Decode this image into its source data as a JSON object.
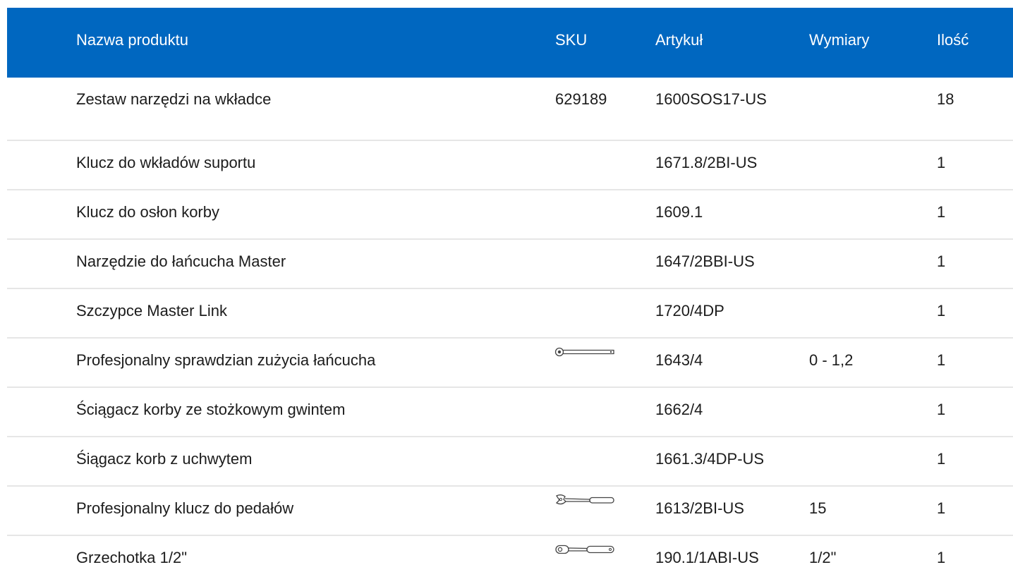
{
  "columns": {
    "name": "Nazwa produktu",
    "sku": "SKU",
    "article": "Artykuł",
    "dimensions": "Wymiary",
    "quantity": "Ilość"
  },
  "rows": [
    {
      "name": "Zestaw narzędzi na wkładce",
      "sku": "629189",
      "article": "1600SOS17-US",
      "dimensions": "",
      "quantity": "18",
      "image": null
    },
    {
      "name": "Klucz do wkładów suportu",
      "sku": "",
      "article": "1671.8/2BI-US",
      "dimensions": "",
      "quantity": "1",
      "image": null
    },
    {
      "name": "Klucz do osłon korby",
      "sku": "",
      "article": "1609.1",
      "dimensions": "",
      "quantity": "1",
      "image": null
    },
    {
      "name": "Narzędzie do łańcucha Master",
      "sku": "",
      "article": "1647/2BBI-US",
      "dimensions": "",
      "quantity": "1",
      "image": null
    },
    {
      "name": "Szczypce Master Link",
      "sku": "",
      "article": "1720/4DP",
      "dimensions": "",
      "quantity": "1",
      "image": null
    },
    {
      "name": "Profesjonalny sprawdzian zużycia łańcucha",
      "sku": "",
      "article": "1643/4",
      "dimensions": "0 - 1,2",
      "quantity": "1",
      "image": "chain-wear-gauge-icon"
    },
    {
      "name": "Ściągacz korby ze stożkowym gwintem",
      "sku": "",
      "article": "1662/4",
      "dimensions": "",
      "quantity": "1",
      "image": null
    },
    {
      "name": "Śiągacz korb z uchwytem",
      "sku": "",
      "article": "1661.3/4DP-US",
      "dimensions": "",
      "quantity": "1",
      "image": null
    },
    {
      "name": "Profesjonalny klucz do pedałów",
      "sku": "",
      "article": "1613/2BI-US",
      "dimensions": "15",
      "quantity": "1",
      "image": "pedal-wrench-icon"
    },
    {
      "name": "Grzechotka 1/2\"",
      "sku": "",
      "article": "190.1/1ABI-US",
      "dimensions": "1/2\"",
      "quantity": "1",
      "image": "ratchet-icon"
    }
  ],
  "colors": {
    "header_bg": "#0067c0",
    "header_text": "#ffffff",
    "row_divider": "#e6e6e6"
  }
}
